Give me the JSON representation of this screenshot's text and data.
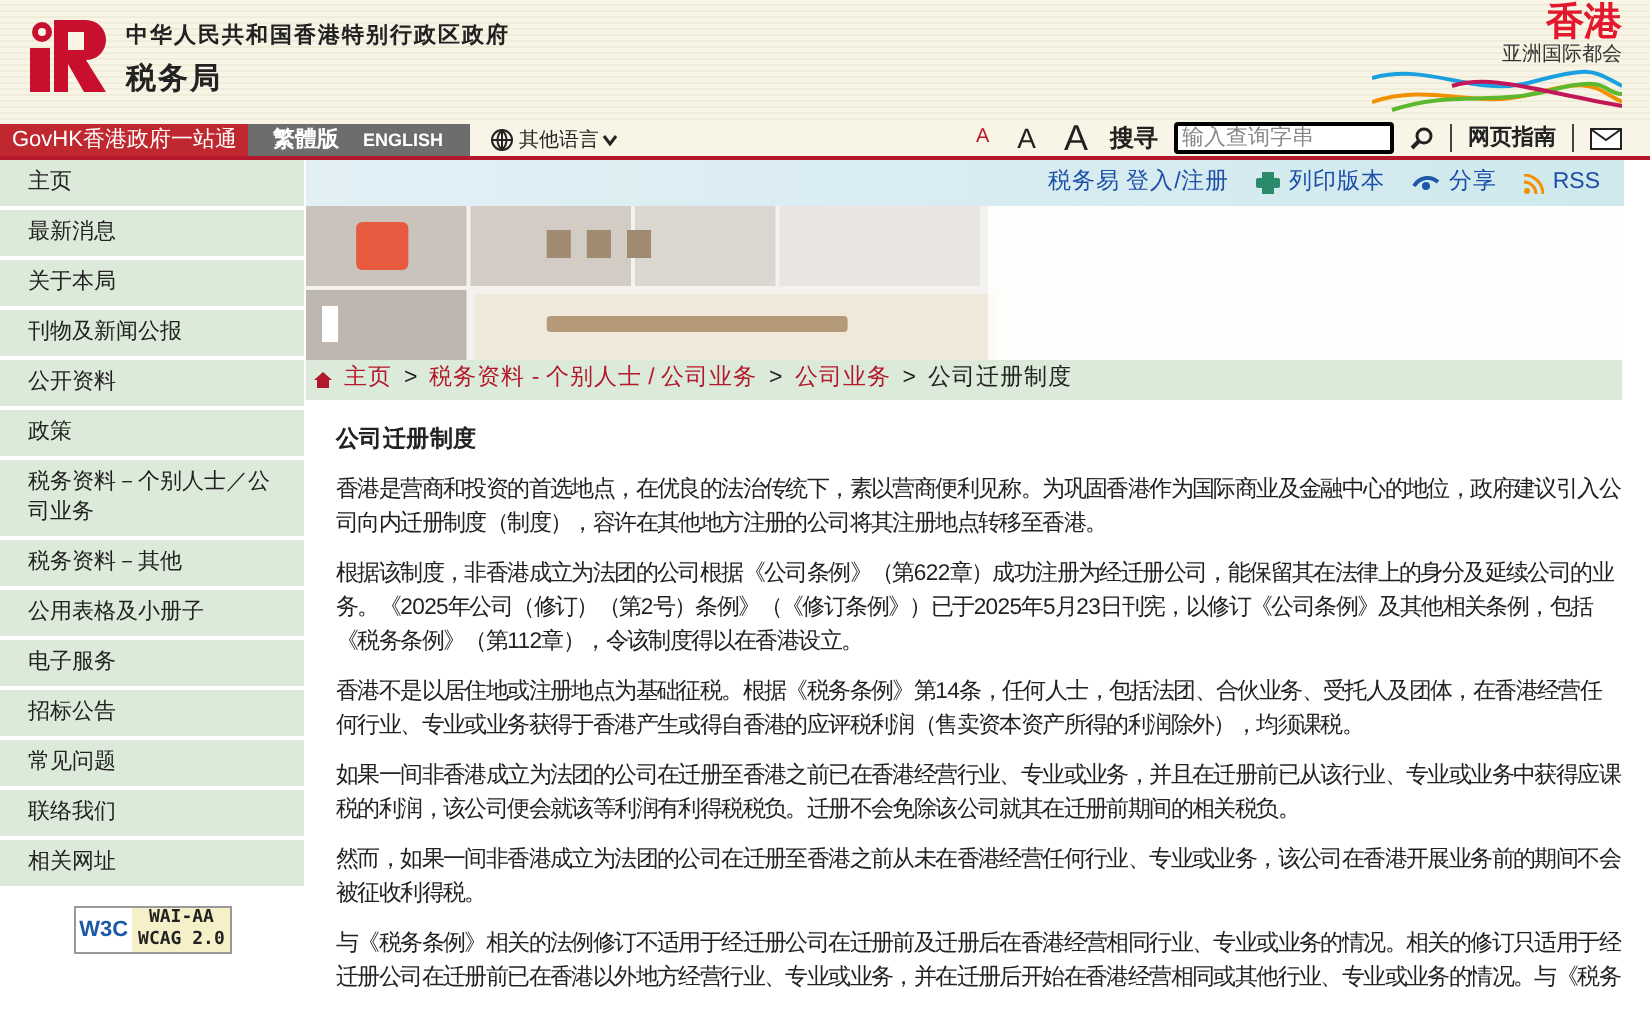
{
  "header": {
    "government": "中华人民共和国香港特别行政区政府",
    "department": "税务局",
    "brand": "香港",
    "brand_tagline": "亚洲国际都会"
  },
  "nav": {
    "links": [
      {
        "label": "GovHK香港政府一站通",
        "kind": "govhk"
      },
      {
        "label": "繁體版",
        "kind": "lang"
      },
      {
        "label": "ENGLISH",
        "kind": "lang"
      }
    ],
    "other_languages": "其他语言"
  },
  "tools": {
    "font_sizes": [
      "A",
      "A",
      "A"
    ],
    "search_label": "搜寻",
    "search": {
      "placeholder": "输入查询字串"
    },
    "guide": "网页指南"
  },
  "toolbar": [
    "税务易 登入/注册",
    "列印版本",
    "分享",
    "RSS"
  ],
  "sidebar": {
    "items": [
      {
        "label": "主页"
      },
      {
        "label": "最新消息"
      },
      {
        "label": "关于本局"
      },
      {
        "label": "刊物及新闻公报"
      },
      {
        "label": "公开资料"
      },
      {
        "label": "政策"
      },
      {
        "label": "税务资料－个别人士／公司业务"
      },
      {
        "label": "税务资料－其他"
      },
      {
        "label": "公用表格及小册子"
      },
      {
        "label": "电子服务"
      },
      {
        "label": "招标公告"
      },
      {
        "label": "常见问题"
      },
      {
        "label": "联络我们"
      },
      {
        "label": "相关网址"
      }
    ],
    "badge": {
      "w3c": "W3C",
      "level": "WAI-AA",
      "standard": "WCAG 2.0"
    }
  },
  "breadcrumb": {
    "links": [
      "主页",
      "税务资料 - 个别人士 / 公司业务",
      "公司业务"
    ],
    "separator": ">",
    "current": "公司迁册制度"
  },
  "content": {
    "title": "公司迁册制度",
    "paragraphs": [
      "香港是营商和投资的首选地点，在优良的法治传统下，素以营商便利见称。为巩固香港作为国际商业及金融中心的地位，政府建议引入公司向内迁册制度（制度），容许在其他地方注册的公司将其注册地点转移至香港。",
      "根据该制度，非香港成立为法团的公司根据《公司条例》（第622章）成功注册为经迁册公司，能保留其在法律上的身分及延续公司的业务。《2025年公司（修订）（第2号）条例》（《修订条例》）已于2025年5月23日刊宪，以修订《公司条例》及其他相关条例，包括《税务条例》（第112章），令该制度得以在香港设立。",
      "香港不是以居住地或注册地点为基础征税。根据《税务条例》第14条，任何人士，包括法团、合伙业务、受托人及团体，在香港经营任何行业、专业或业务获得于香港产生或得自香港的应评税利润（售卖资本资产所得的利润除外），均须课税。",
      "如果一间非香港成立为法团的公司在迁册至香港之前已在香港经营行业、专业或业务，并且在迁册前已从该行业、专业或业务中获得应课税的利润，该公司便会就该等利润有利得税税负。迁册不会免除该公司就其在迁册前期间的相关税负。",
      "然而，如果一间非香港成立为法团的公司在迁册至香港之前从未在香港经营任何行业、专业或业务，该公司在香港开展业务前的期间不会被征收利得税。",
      "与《税务条例》相关的法例修订不适用于经迁册公司在迁册前及迁册后在香港经营相同行业、专业或业务的情况。相关的修订只适用于经迁册公司在迁册前已在香港以外地方经营行业、专业或业务，并在迁册后开始在香港经营相同或其他行业、专业或业务的情况。与《税务"
    ]
  }
}
